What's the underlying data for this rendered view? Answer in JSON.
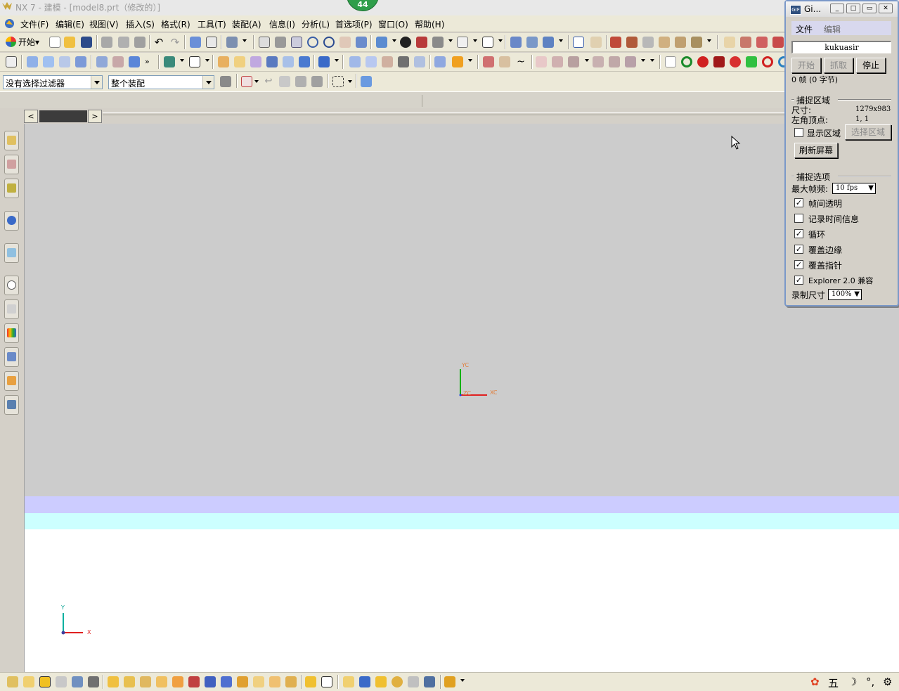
{
  "window": {
    "title": "NX 7 - 建模 - [model8.prt（修改的）]",
    "badge": "44"
  },
  "menu": [
    "文件(F)",
    "编辑(E)",
    "视图(V)",
    "插入(S)",
    "格式(R)",
    "工具(T)",
    "装配(A)",
    "信息(I)",
    "分析(L)",
    "首选项(P)",
    "窗口(O)",
    "帮助(H)"
  ],
  "toolbar": {
    "start_label": "开始"
  },
  "filters": {
    "selection_filter": "没有选择过滤器",
    "assembly_scope": "整个装配"
  },
  "viewport": {
    "wcs_labels": {
      "yc": "YC",
      "xc": "XC",
      "zc": "ZC"
    },
    "triad_labels": {
      "y": "Y",
      "x": "X"
    }
  },
  "capture_window": {
    "title": "Gi...",
    "menu": [
      "文件",
      "编辑"
    ],
    "user": "kukuasir",
    "buttons": {
      "start": "开始",
      "grab": "抓取",
      "stop": "停止"
    },
    "frame_info": "0 帧 (0 字节)",
    "capture_area": {
      "heading": "捕捉区域",
      "size_label": "尺寸:",
      "size_value": "1279x983",
      "corner_label": "左角顶点:",
      "corner_value": "1, 1",
      "show_area_label": "显示区域",
      "show_area_checked": false,
      "select_area_button": "选择区域",
      "refresh_button": "刷新屏幕"
    },
    "capture_options": {
      "heading": "捕捉选项",
      "max_fps_label": "最大帧频:",
      "max_fps_value": "10 fps",
      "options": [
        {
          "label": "帧间透明",
          "checked": true
        },
        {
          "label": "记录时间信息",
          "checked": false
        },
        {
          "label": "循环",
          "checked": true
        },
        {
          "label": "覆盖边缘",
          "checked": true
        },
        {
          "label": "覆盖指针",
          "checked": true
        },
        {
          "label": "Explorer 2.0 兼容",
          "checked": true
        }
      ],
      "record_size_label": "录制尺寸",
      "record_size_value": "100%"
    }
  },
  "tray": [
    "五"
  ]
}
